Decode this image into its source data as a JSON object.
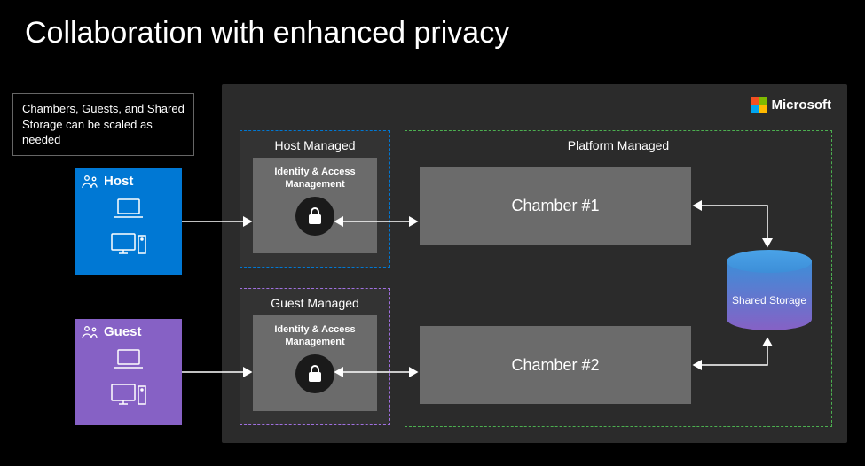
{
  "title": "Collaboration with enhanced privacy",
  "note": "Chambers, Guests, and Shared Storage can be scaled as needed",
  "brand": "Microsoft",
  "orgs": {
    "host": {
      "label": "Host"
    },
    "guest": {
      "label": "Guest"
    }
  },
  "zones": {
    "host_managed": "Host Managed",
    "guest_managed": "Guest Managed",
    "platform_managed": "Platform Managed"
  },
  "iam": {
    "label": "Identity & Access Management"
  },
  "chambers": {
    "c1": "Chamber #1",
    "c2": "Chamber #2"
  },
  "storage": {
    "label": "Shared Storage"
  },
  "colors": {
    "host": "#0078d4",
    "guest": "#8661c5",
    "platform_border": "#4caf50",
    "panel": "#2b2b2b",
    "block": "#6b6b6b"
  }
}
